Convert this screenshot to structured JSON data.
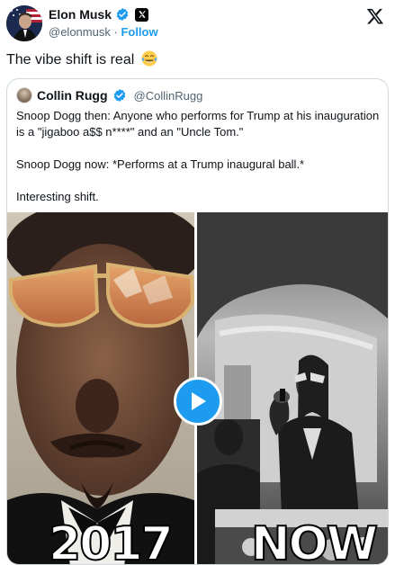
{
  "author": {
    "name": "Elon Musk",
    "handle": "@elonmusk",
    "separator": "·",
    "follow_label": "Follow"
  },
  "tweet": {
    "text": "The vibe shift is real",
    "emoji": "face-with-tears-of-joy"
  },
  "quoted": {
    "name": "Collin Rugg",
    "handle": "@CollinRugg",
    "paragraphs": [
      "Snoop Dogg then: Anyone who performs for Trump at his inauguration is a \"jigaboo a$$ n****\" and an \"Uncle Tom.\"",
      "Snoop Dogg now: *Performs at a Trump inaugural ball.*",
      "Interesting shift."
    ]
  },
  "media": {
    "left_caption": "2017",
    "right_caption": "NOW",
    "play_icon": "play-icon"
  },
  "colors": {
    "accent": "#1d9bf0",
    "text": "#0f1419",
    "muted": "#536471",
    "border": "#cfd9de"
  }
}
